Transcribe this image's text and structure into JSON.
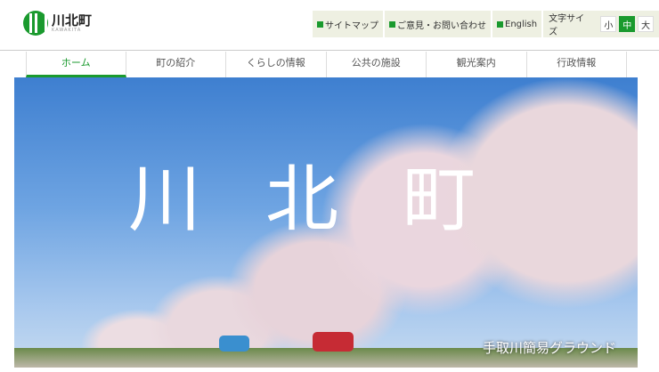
{
  "logo": {
    "name": "川北町",
    "sub": "KAWAKITA"
  },
  "util": {
    "sitemap": "サイトマップ",
    "contact": "ご意見・お問い合わせ",
    "english": "English",
    "font_size_label": "文字サイズ",
    "sizes": [
      "小",
      "中",
      "大"
    ]
  },
  "nav": [
    "ホーム",
    "町の紹介",
    "くらしの情報",
    "公共の施設",
    "観光案内",
    "行政情報"
  ],
  "hero": {
    "title": "川北町",
    "caption": "手取川簡易グラウンド"
  }
}
